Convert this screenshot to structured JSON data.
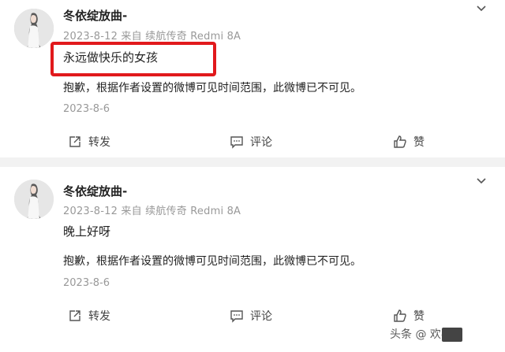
{
  "posts": [
    {
      "username": "冬依绽放曲-",
      "meta": "2023-8-12 来自 续航传奇 Redmi 8A",
      "text": "永远做快乐的女孩",
      "highlighted": true,
      "notice": "抱歉，根据作者设置的微博可见时间范围，此微博已不可见。",
      "date": "2023-8-6",
      "actions": {
        "repost": "转发",
        "comment": "评论",
        "like": "赞"
      }
    },
    {
      "username": "冬依绽放曲-",
      "meta": "2023-8-12 来自 续航传奇 Redmi 8A",
      "text": "晚上好呀",
      "highlighted": false,
      "notice": "抱歉，根据作者设置的微博可见时间范围，此微博已不可见。",
      "date": "2023-8-6",
      "actions": {
        "repost": "转发",
        "comment": "评论",
        "like": "赞"
      }
    }
  ],
  "watermark": "头条 @ 欢喜",
  "colors": {
    "highlight_border": "#e1191c",
    "meta_gray": "#999999",
    "background": "#f2f2f2"
  },
  "icons": [
    "avatar-photo",
    "chevron-down-icon",
    "repost-icon",
    "comment-icon",
    "like-icon"
  ]
}
